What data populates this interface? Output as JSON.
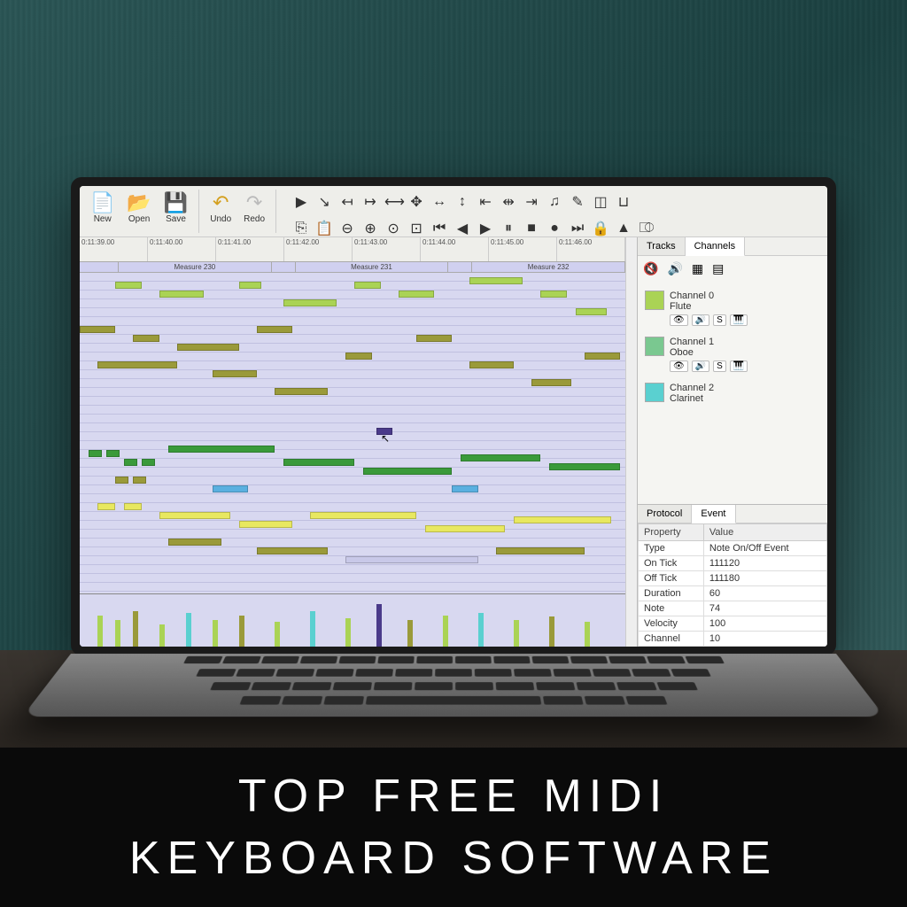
{
  "caption": {
    "line1": "TOP FREE MIDI",
    "line2": "KEYBOARD SOFTWARE"
  },
  "toolbar": {
    "new": "New",
    "open": "Open",
    "save": "Save",
    "undo": "Undo",
    "redo": "Redo"
  },
  "timeline": {
    "times": [
      "0:11:39.00",
      "0:11:40.00",
      "0:11:41.00",
      "0:11:42.00",
      "0:11:43.00",
      "0:11:44.00",
      "0:11:45.00",
      "0:11:46.00"
    ],
    "measures": [
      "",
      "Measure 230",
      "",
      "Measure 231",
      "",
      "Measure 232",
      ""
    ]
  },
  "sidebar": {
    "tabs": {
      "tracks": "Tracks",
      "channels": "Channels"
    },
    "channels": [
      {
        "name": "Channel 0",
        "instrument": "Flute",
        "color": "#aad355",
        "sLabel": "S"
      },
      {
        "name": "Channel 1",
        "instrument": "Oboe",
        "color": "#7ac890",
        "sLabel": "S"
      },
      {
        "name": "Channel 2",
        "instrument": "Clarinet",
        "color": "#5ad0d0",
        "sLabel": "S"
      }
    ]
  },
  "event": {
    "tabs": {
      "protocol": "Protocol",
      "event": "Event"
    },
    "header": {
      "prop": "Property",
      "val": "Value"
    },
    "rows": [
      {
        "p": "Type",
        "v": "Note On/Off Event"
      },
      {
        "p": "On Tick",
        "v": "111120"
      },
      {
        "p": "Off Tick",
        "v": "111180"
      },
      {
        "p": "Duration",
        "v": "60"
      },
      {
        "p": "Note",
        "v": "74"
      },
      {
        "p": "Velocity",
        "v": "100"
      },
      {
        "p": "Channel",
        "v": "10"
      }
    ]
  }
}
